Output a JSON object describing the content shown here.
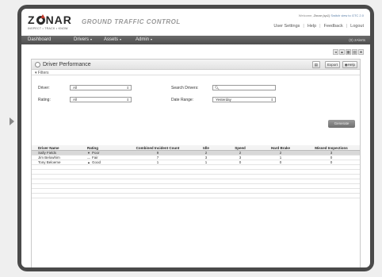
{
  "header": {
    "logo": "Z NAR",
    "logo_left": "Z",
    "logo_right": "NAR",
    "tagline": "INSPECT • TRACK • KNOW",
    "product": "GROUND TRAFFIC CONTROL",
    "welcome_prefix": "Welcome,",
    "welcome_user": "Zonar (sp1)",
    "welcome_link": "Switch view to GTC 2.0",
    "links": [
      "User Settings",
      "Help",
      "Feedback",
      "Logout"
    ]
  },
  "nav": {
    "items": [
      {
        "label": "Dashboard",
        "caret": false
      },
      {
        "label": "Drivers",
        "caret": true
      },
      {
        "label": "Assets",
        "caret": true
      },
      {
        "label": "Admin",
        "caret": true
      }
    ],
    "alerts": "(0) 2Alerts"
  },
  "panel": {
    "title": "Driver Performance",
    "export_label": "Export",
    "help_label": "Help",
    "filters_label": "Filters"
  },
  "filters": {
    "driver_label": "Driver:",
    "driver_value": "All",
    "rating_label": "Rating:",
    "rating_value": "All",
    "search_label": "Search Drivers:",
    "search_value": "",
    "date_label": "Date Range:",
    "date_value": "Yesterday",
    "generate_label": "Generate"
  },
  "grid": {
    "columns": [
      "Driver Name",
      "Rating",
      "Combined Incident Count",
      "Idle",
      "Speed",
      "Hard Brake",
      "Missed Inspections"
    ],
    "rows": [
      {
        "name": "Sally Fields",
        "rating": "Poor",
        "rating_icon": "thumbs-down-icon",
        "combined": "9",
        "idle": "2",
        "speed": "2",
        "hard_brake": "2",
        "missed": "3",
        "selected": true
      },
      {
        "name": "Jim Belowhim",
        "rating": "Fair",
        "rating_icon": "dash-icon",
        "combined": "7",
        "idle": "3",
        "speed": "3",
        "hard_brake": "1",
        "missed": "0",
        "selected": false
      },
      {
        "name": "Tony Beloeme",
        "rating": "Good",
        "rating_icon": "thumbs-up-icon",
        "combined": "1",
        "idle": "1",
        "speed": "0",
        "hard_brake": "0",
        "missed": "0",
        "selected": false
      }
    ]
  },
  "colors": {
    "nav_bg": "#555555",
    "selected_row": "#d8d8d8",
    "brand_accent": "#c0392b"
  }
}
